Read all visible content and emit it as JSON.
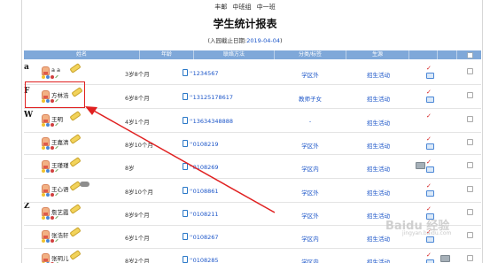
{
  "breadcrumb": [
    "丰邮",
    "中班组",
    "中一班"
  ],
  "title": "学生统计报表",
  "subtitle_prefix": "(入园截止日期:",
  "subtitle_date": "2019-04-04",
  "subtitle_suffix": ")",
  "columns": [
    "姓名",
    "年龄",
    "联络方法",
    "分类/标签",
    "生源"
  ],
  "group_letters": [
    {
      "letter": "a"
    },
    {
      "letter": "F"
    },
    {
      "letter": "W"
    },
    {
      "letter": "Z"
    }
  ],
  "rows": [
    {
      "name": "a a",
      "age": "3岁8个月",
      "phone": "1234567",
      "category": "学区外",
      "source": "招生活动",
      "screen": true
    },
    {
      "name": "方林浩",
      "age": "6岁8个月",
      "phone": "13125178617",
      "category": "教师子女",
      "source": "招生活动",
      "screen": true
    },
    {
      "name": "王明",
      "age": "4岁1个月",
      "phone": "13634348888",
      "category": "-",
      "source": "招生活动",
      "screen": false
    },
    {
      "name": "王嘉清",
      "age": "8岁10个月",
      "phone": "0108219",
      "category": "学区外",
      "source": "招生活动",
      "screen": true
    },
    {
      "name": "王瑾瑾",
      "age": "8岁",
      "phone": "0108269",
      "category": "学区内",
      "source": "招生活动",
      "screen": true
    },
    {
      "name": "王心语",
      "age": "8岁10个月",
      "phone": "0108861",
      "category": "学区外",
      "source": "招生活动",
      "screen": true
    },
    {
      "name": "詹艺霞",
      "age": "8岁9个月",
      "phone": "0108211",
      "category": "学区外",
      "source": "招生活动",
      "screen": true
    },
    {
      "name": "张浩轩",
      "age": "6岁1个月",
      "phone": "0108267",
      "category": "学区内",
      "source": "招生活动",
      "screen": true
    },
    {
      "name": "张玥儿",
      "age": "8岁2个月",
      "phone": "0108285",
      "category": "学区内",
      "source": "招生活动",
      "screen": true
    }
  ],
  "check_mark": "✓",
  "phone_prefix": "''",
  "watermark": "Baidu 经验",
  "watermark_sub": "jingyan.baidu.com",
  "colors": {
    "header_bg": "#7fa8d9",
    "link": "#1a54c8",
    "highlight": "#e02020",
    "check": "#d42020"
  }
}
